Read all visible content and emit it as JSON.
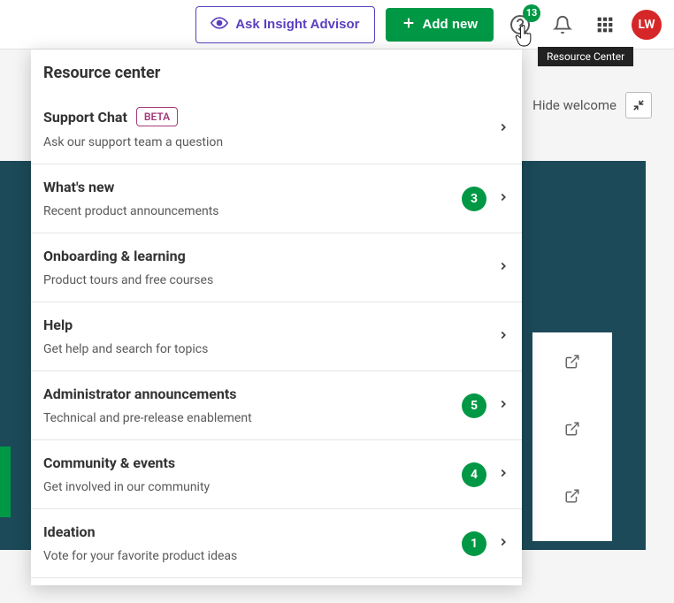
{
  "topbar": {
    "ask_insight": "Ask Insight Advisor",
    "add_new": "Add new",
    "help_badge": "13",
    "avatar": "LW"
  },
  "tooltip": "Resource Center",
  "hide_welcome": "Hide welcome",
  "panel": {
    "header": "Resource center",
    "items": [
      {
        "title": "Support Chat",
        "sub": "Ask our support team a question",
        "beta": "BETA",
        "count": null
      },
      {
        "title": "What's new",
        "sub": "Recent product announcements",
        "beta": null,
        "count": "3"
      },
      {
        "title": "Onboarding & learning",
        "sub": "Product tours and free courses",
        "beta": null,
        "count": null
      },
      {
        "title": "Help",
        "sub": "Get help and search for topics",
        "beta": null,
        "count": null
      },
      {
        "title": "Administrator announcements",
        "sub": "Technical and pre-release enablement",
        "beta": null,
        "count": "5"
      },
      {
        "title": "Community & events",
        "sub": "Get involved in our community",
        "beta": null,
        "count": "4"
      },
      {
        "title": "Ideation",
        "sub": "Vote for your favorite product ideas",
        "beta": null,
        "count": "1"
      }
    ]
  }
}
